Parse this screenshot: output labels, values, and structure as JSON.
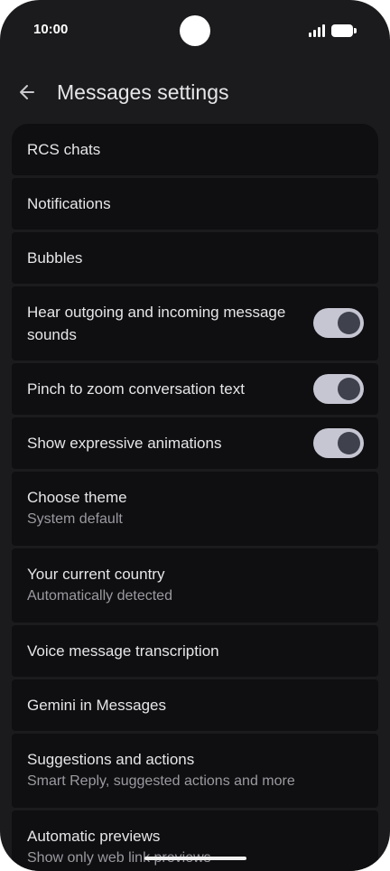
{
  "status": {
    "time": "10:00"
  },
  "header": {
    "title": "Messages settings"
  },
  "settings": {
    "rcs_chats": {
      "label": "RCS chats"
    },
    "notifications": {
      "label": "Notifications"
    },
    "bubbles": {
      "label": "Bubbles"
    },
    "hear_sounds": {
      "label": "Hear outgoing and incoming message sounds",
      "enabled": true
    },
    "pinch_zoom": {
      "label": "Pinch to zoom conversation text",
      "enabled": true
    },
    "expressive_animations": {
      "label": "Show expressive animations",
      "enabled": true
    },
    "choose_theme": {
      "label": "Choose theme",
      "value": "System default"
    },
    "current_country": {
      "label": "Your current country",
      "value": "Automatically detected"
    },
    "voice_transcription": {
      "label": "Voice message transcription"
    },
    "gemini": {
      "label": "Gemini in Messages"
    },
    "suggestions": {
      "label": "Suggestions and actions",
      "value": "Smart Reply, suggested actions and more"
    },
    "automatic_previews": {
      "label": "Automatic previews",
      "value": "Show only web link previews"
    }
  },
  "colors": {
    "background": "#1b1b1d",
    "item_background": "#0f0f11",
    "toggle_track": "#c5c6d2",
    "toggle_knob": "#3f414c"
  },
  "icons": {
    "back": "arrow-left-icon",
    "signal": "signal-icon",
    "battery": "battery-icon"
  }
}
